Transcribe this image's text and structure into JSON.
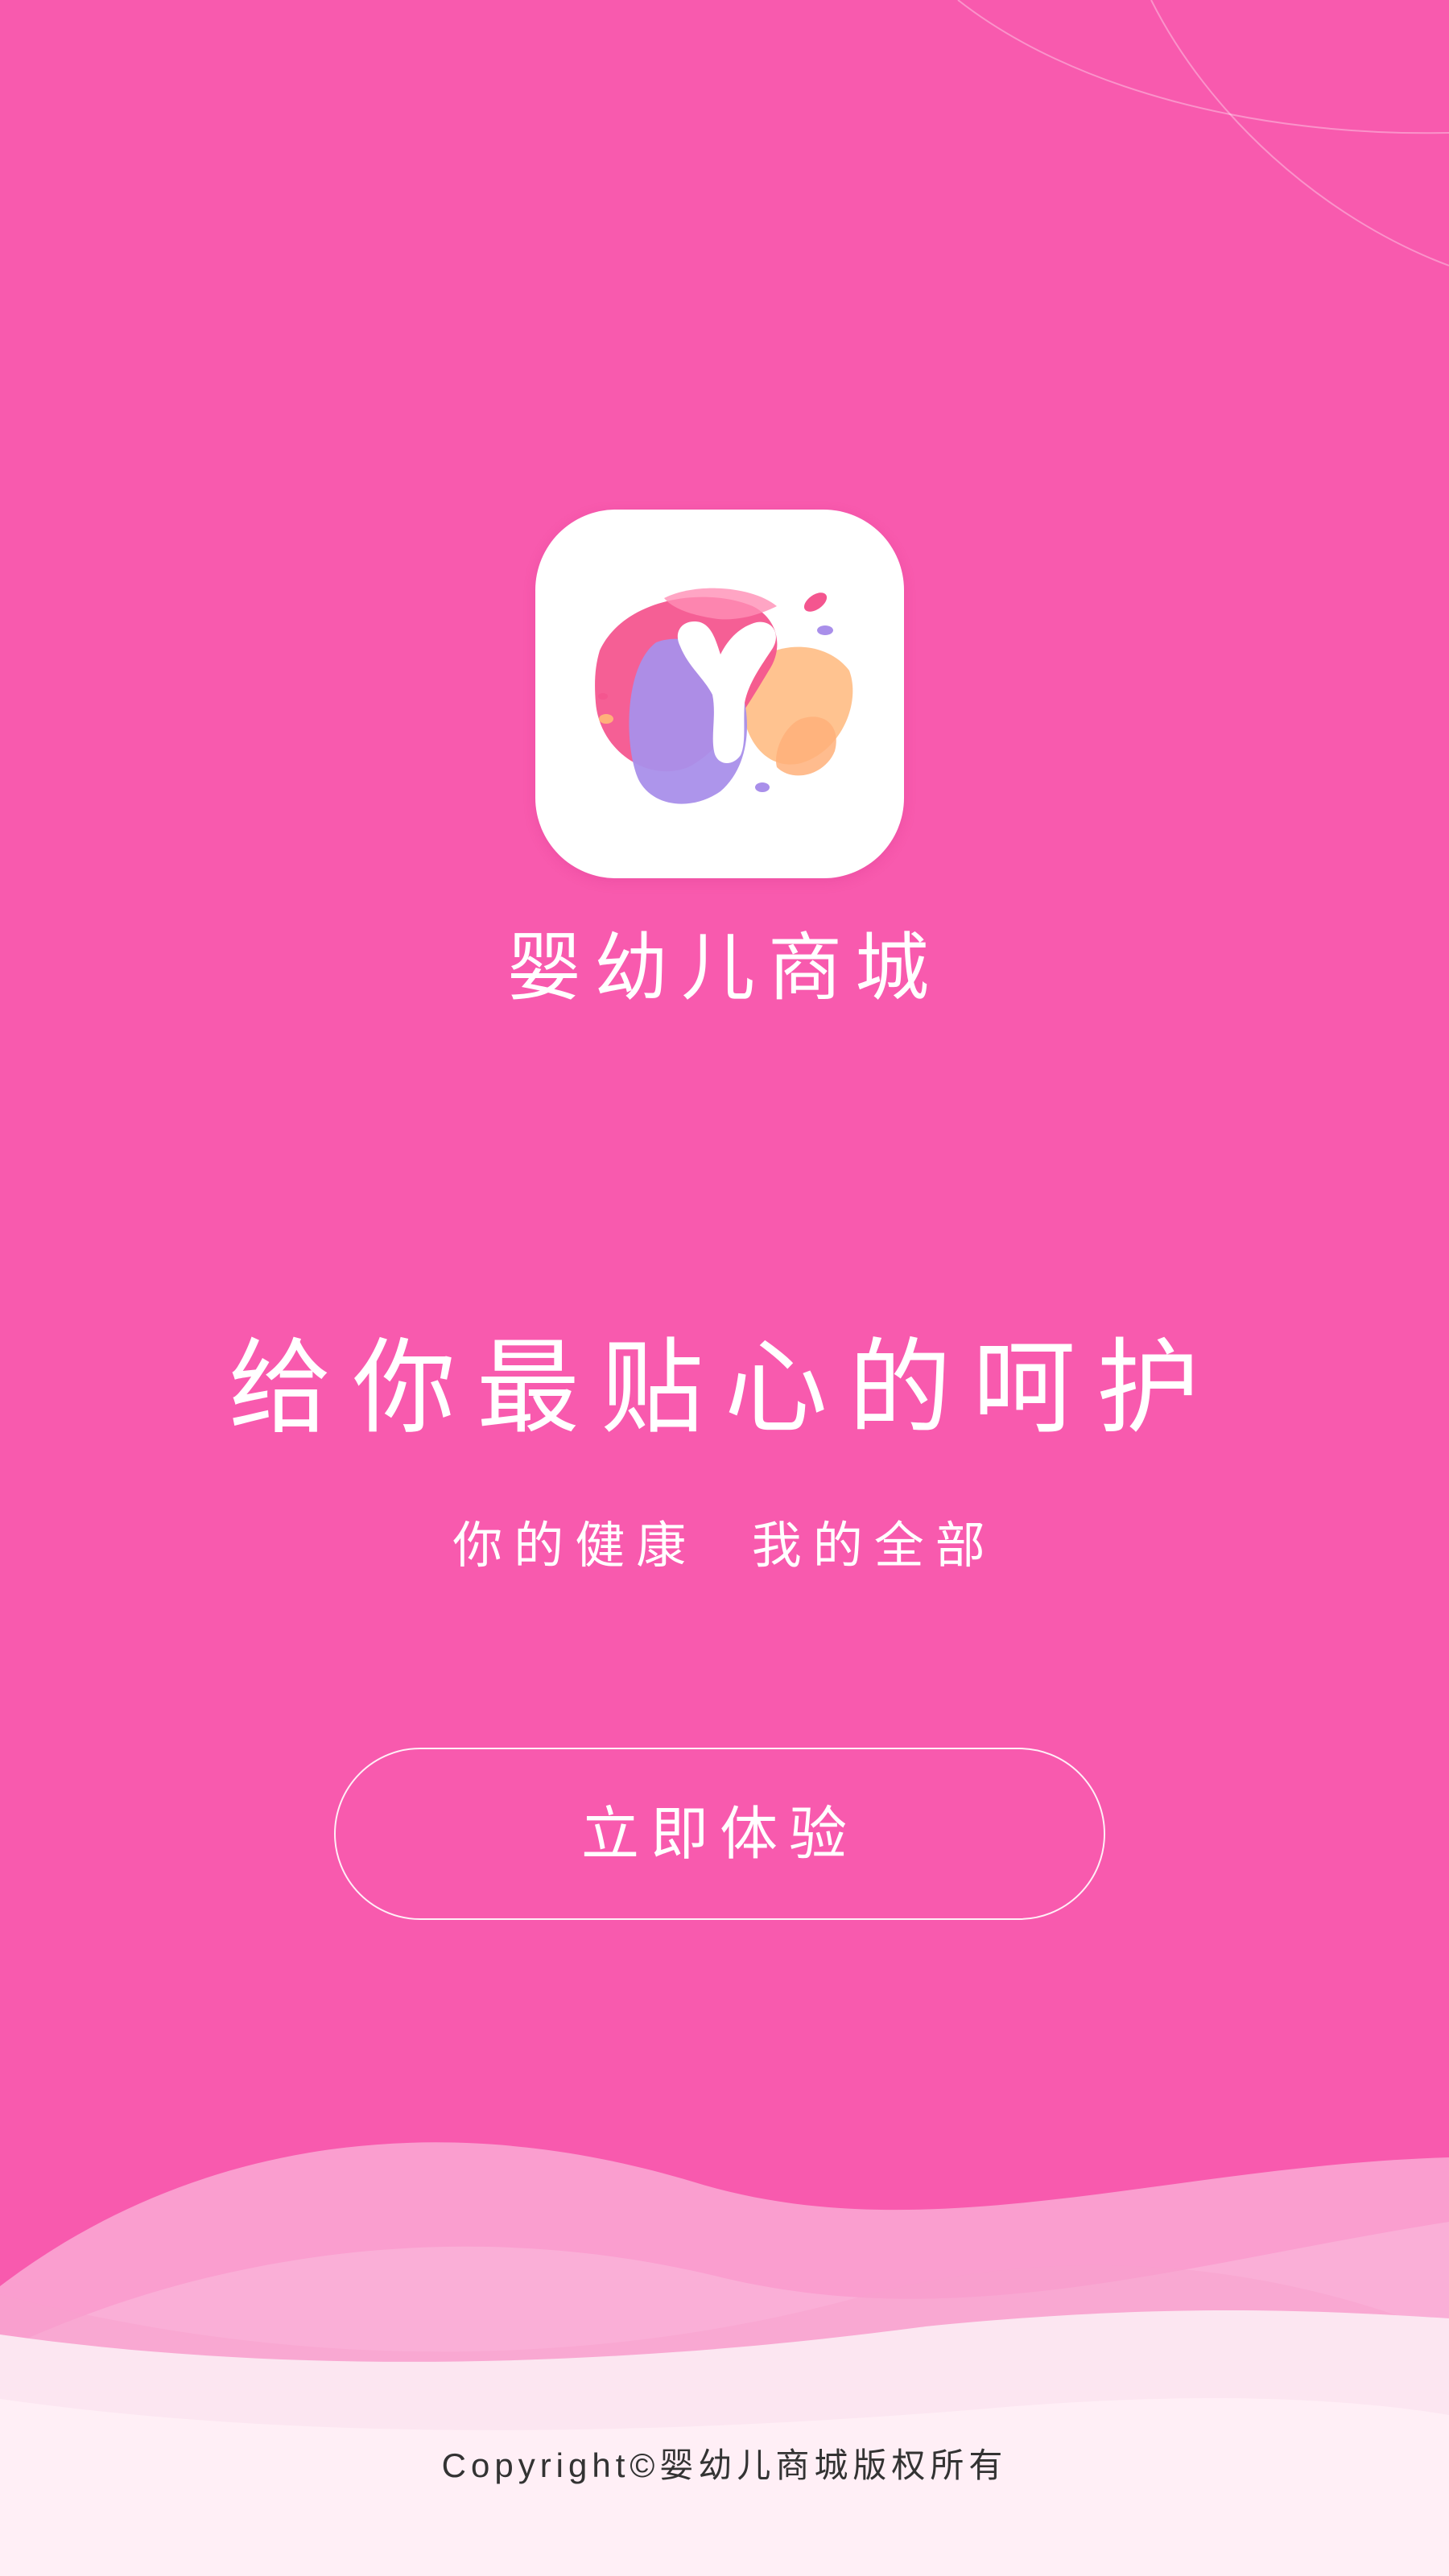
{
  "app": {
    "name": "婴幼儿商城",
    "icon": "app-logo-y-icon"
  },
  "hero": {
    "headline": "给你最贴心的呵护",
    "subline": "你的健康  我的全部"
  },
  "cta": {
    "label": "立即体验"
  },
  "footer": {
    "copyright": "Copyright©婴幼儿商城版权所有"
  },
  "colors": {
    "background": "#F85AAE",
    "accent_white": "#FFFFFF",
    "wave_light": "#FCE6F1",
    "logo_pink": "#F4568F",
    "logo_purple": "#A98FEA",
    "logo_orange": "#FFC08A"
  }
}
